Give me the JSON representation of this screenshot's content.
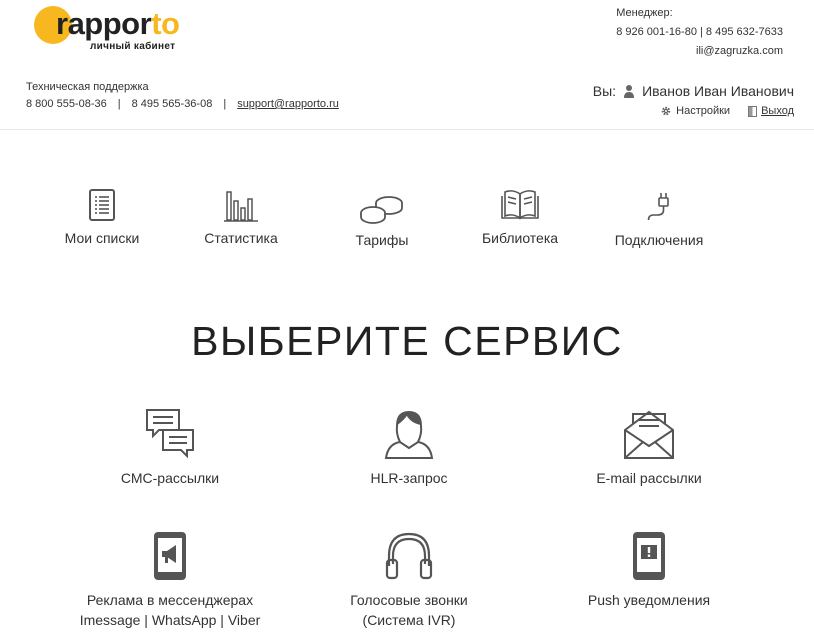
{
  "logo": {
    "brand_main": "rappor",
    "brand_accent": "to",
    "subtitle": "личный кабинет"
  },
  "manager": {
    "label": "Менеджер:",
    "phones": "8 926 001-16-80 | 8 495 632-7633",
    "email": "ili@zagruzka.com"
  },
  "support": {
    "label": "Техническая поддержка",
    "phone1": "8 800 555-08-36",
    "separator": "|",
    "phone2": "8 495 565-36-08",
    "email": "support@rapporto.ru"
  },
  "user": {
    "you_label": "Вы:",
    "name": "Иванов Иван Иванович",
    "settings": "Настройки",
    "logout": "Выход"
  },
  "nav": [
    {
      "label": "Мои списки",
      "icon": "list-icon"
    },
    {
      "label": "Статистика",
      "icon": "bar-chart-icon"
    },
    {
      "label": "Тарифы",
      "icon": "coins-icon"
    },
    {
      "label": "Библиотека",
      "icon": "book-icon"
    },
    {
      "label": "Подключения",
      "icon": "plug-icon"
    }
  ],
  "heading": "ВЫБЕРИТЕ СЕРВИС",
  "services": [
    {
      "line1": "СМС-рассылки",
      "line2": "",
      "icon": "chat-bubbles-icon"
    },
    {
      "line1": "HLR-запрос",
      "line2": "",
      "icon": "person-icon"
    },
    {
      "line1": "E-mail рассылки",
      "line2": "",
      "icon": "envelope-icon"
    },
    {
      "line1": "Реклама в мессенджерах",
      "line2": "Imessage | WhatsApp | Viber",
      "icon": "phone-megaphone-icon"
    },
    {
      "line1": "Голосовые звонки",
      "line2": "(Система IVR)",
      "icon": "headphones-icon"
    },
    {
      "line1": "Push уведомления",
      "line2": "",
      "icon": "phone-alert-icon"
    }
  ],
  "colors": {
    "accent": "#f7b81f",
    "icon_stroke": "#555555",
    "text": "#333333"
  }
}
